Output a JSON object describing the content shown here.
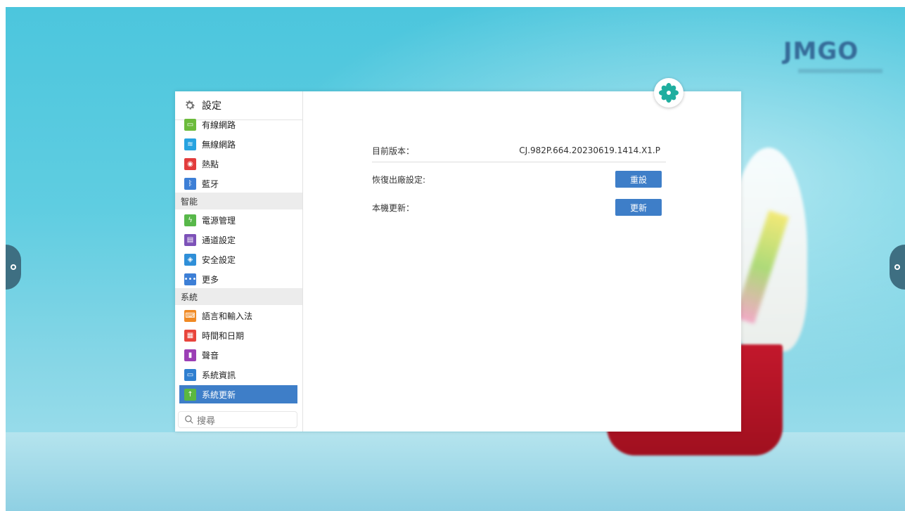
{
  "sidebar": {
    "title": "設定",
    "items_top": [
      {
        "label": "有線網路",
        "icon": "ethernet-icon",
        "color": "#6cbb3c"
      },
      {
        "label": "無線網路",
        "icon": "wifi-icon",
        "color": "#27a3e0"
      },
      {
        "label": "熱點",
        "icon": "hotspot-icon",
        "color": "#e23c3c"
      },
      {
        "label": "藍牙",
        "icon": "bluetooth-icon",
        "color": "#3d7fd6"
      }
    ],
    "section_smart": "智能",
    "items_smart": [
      {
        "label": "電源管理",
        "icon": "power-icon",
        "color": "#58b84a"
      },
      {
        "label": "通道設定",
        "icon": "channel-icon",
        "color": "#7d52b8"
      },
      {
        "label": "安全設定",
        "icon": "shield-icon",
        "color": "#2f8fd8"
      },
      {
        "label": "更多",
        "icon": "more-icon",
        "color": "#3d7fd6"
      }
    ],
    "section_system": "系統",
    "items_system": [
      {
        "label": "語言和輸入法",
        "icon": "keyboard-icon",
        "color": "#f08a24"
      },
      {
        "label": "時間和日期",
        "icon": "calendar-icon",
        "color": "#e8453c"
      },
      {
        "label": "聲音",
        "icon": "speaker-icon",
        "color": "#9b3fb5"
      },
      {
        "label": "系統資訊",
        "icon": "info-icon",
        "color": "#2f7fd0"
      },
      {
        "label": "系統更新",
        "icon": "update-icon",
        "color": "#5bb840"
      }
    ],
    "search_placeholder": "搜尋"
  },
  "content": {
    "version_label": "目前版本：",
    "version_value": "CJ.982P.664.20230619.1414.X1.P",
    "reset_label": "恢復出廠設定:",
    "reset_button": "重設",
    "update_label": "本機更新：",
    "update_button": "更新"
  },
  "colors": {
    "accent": "#3e7ec8",
    "brand_blue": "#2c5a8c"
  },
  "brand_text": "JMGO"
}
